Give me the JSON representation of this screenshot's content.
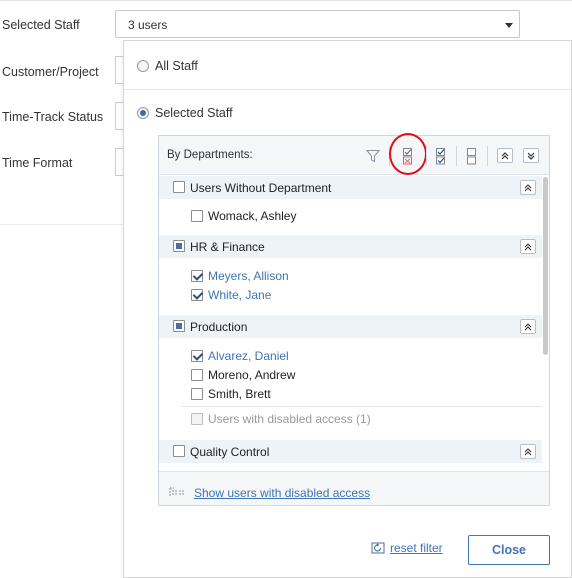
{
  "form": {
    "selected_staff_label": "Selected Staff",
    "selected_staff_value": "3 users",
    "customer_project_label": "Customer/Project",
    "time_track_status_label": "Time-Track Status",
    "time_format_label": "Time Format"
  },
  "panel": {
    "all_staff_label": "All Staff",
    "selected_staff_label": "Selected Staff",
    "selected_option": "Selected Staff",
    "group_by_title": "By Departments:",
    "toolbar_icons": [
      "filter-icon",
      "invert-selection-icon",
      "check-all-icon",
      "uncheck-all-icon",
      "expand-all-icon",
      "collapse-all-icon"
    ],
    "departments": [
      {
        "name": "Users Without Department",
        "state": "unchecked",
        "users": [
          {
            "name": "Womack, Ashley",
            "checked": false
          }
        ]
      },
      {
        "name": "HR & Finance",
        "state": "partial",
        "users": [
          {
            "name": "Meyers, Allison",
            "checked": true
          },
          {
            "name": "White, Jane",
            "checked": true
          }
        ]
      },
      {
        "name": "Production",
        "state": "partial",
        "users": [
          {
            "name": "Alvarez, Daniel",
            "checked": true
          },
          {
            "name": "Moreno, Andrew",
            "checked": false
          },
          {
            "name": "Smith, Brett",
            "checked": false
          }
        ],
        "disabled_label": "Users with disabled access (1)"
      },
      {
        "name": "Quality Control",
        "state": "unchecked",
        "users": []
      }
    ],
    "show_disabled_link": "Show users with disabled access",
    "reset_filter_label": "reset filter",
    "close_label": "Close"
  },
  "colors": {
    "accent": "#3f74b5",
    "highlight_circle": "#e0101a",
    "dept_row_bg": "#eef3f8"
  }
}
